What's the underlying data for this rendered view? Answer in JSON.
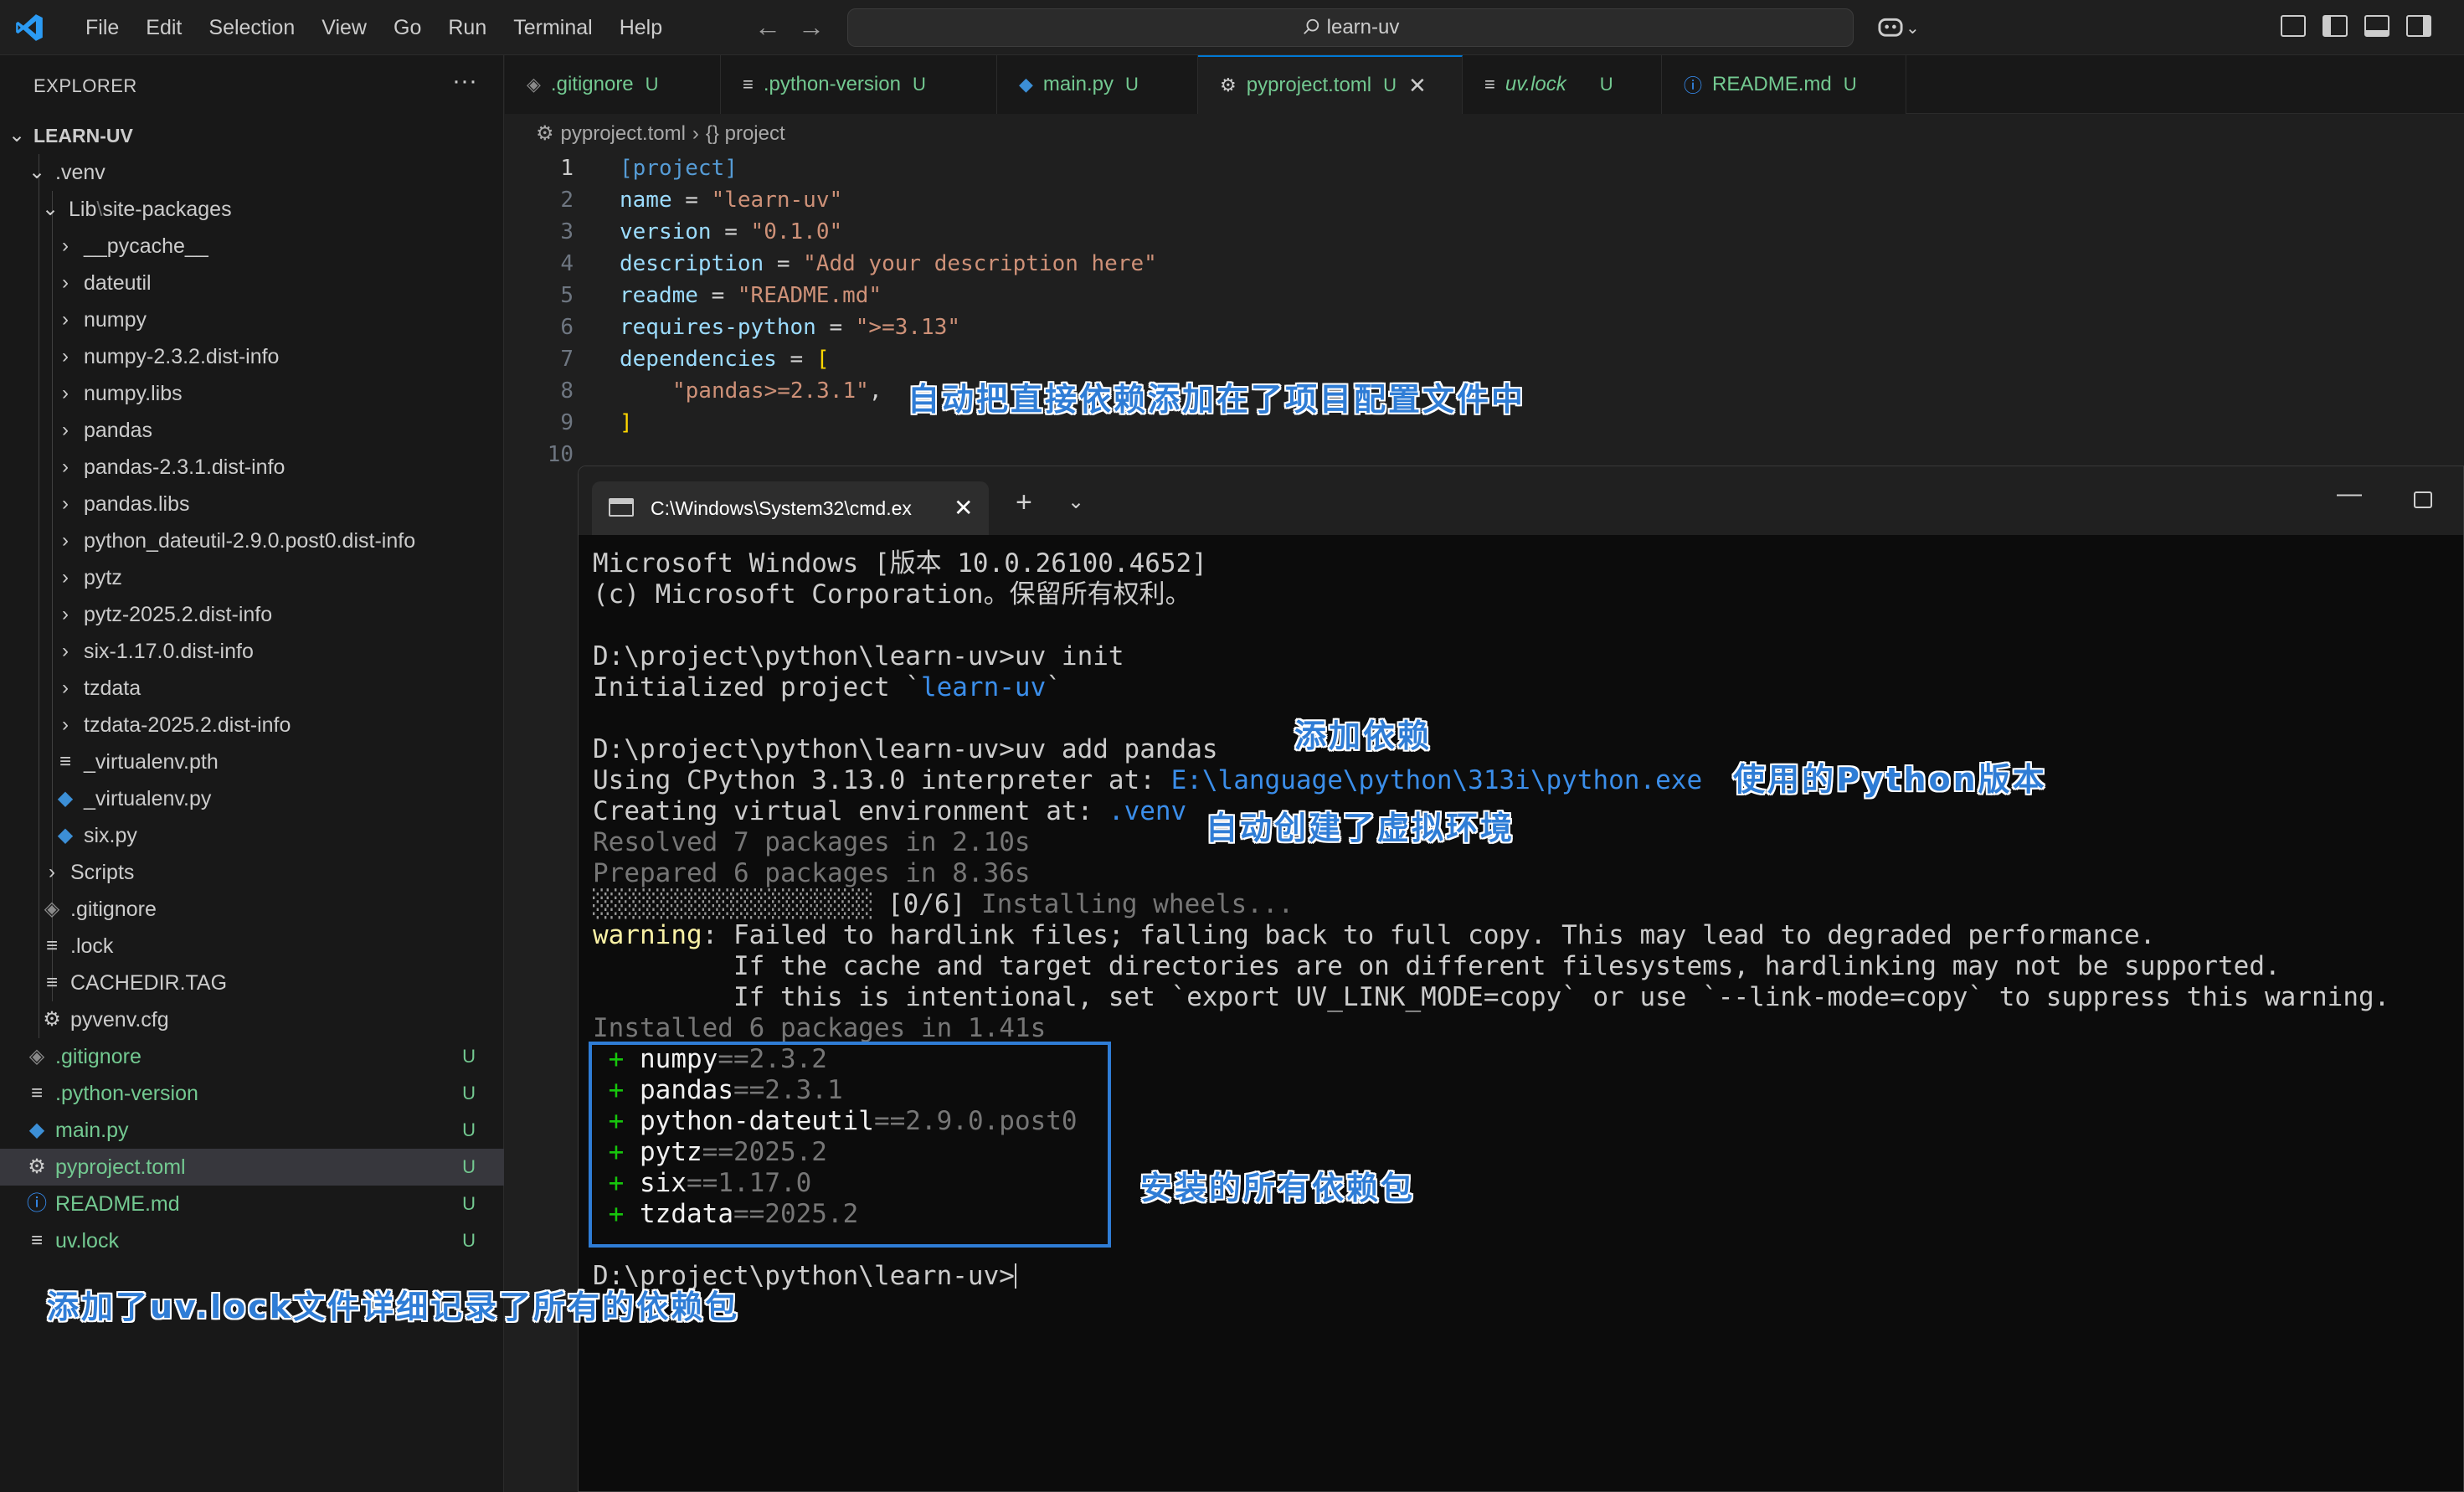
{
  "titlebar": {
    "menus": [
      "File",
      "Edit",
      "Selection",
      "View",
      "Go",
      "Run",
      "Terminal",
      "Help"
    ],
    "search_text": "learn-uv"
  },
  "sidebar": {
    "title": "EXPLORER",
    "more": "···",
    "root": "LEARN-UV",
    "venv": ".venv",
    "lib": "Lib",
    "lib_sep": "\\",
    "site_packages": "site-packages",
    "folders": [
      "__pycache__",
      "dateutil",
      "numpy",
      "numpy-2.3.2.dist-info",
      "numpy.libs",
      "pandas",
      "pandas-2.3.1.dist-info",
      "pandas.libs",
      "python_dateutil-2.9.0.post0.dist-info",
      "pytz",
      "pytz-2025.2.dist-info",
      "six-1.17.0.dist-info",
      "tzdata",
      "tzdata-2025.2.dist-info"
    ],
    "files": [
      "_virtualenv.pth",
      "_virtualenv.py",
      "six.py"
    ],
    "scripts": "Scripts",
    "venv_files": [
      ".gitignore",
      ".lock",
      "CACHEDIR.TAG",
      "pyvenv.cfg"
    ],
    "project_files": [
      {
        "name": ".gitignore",
        "status": "U"
      },
      {
        "name": ".python-version",
        "status": "U"
      },
      {
        "name": "main.py",
        "status": "U"
      },
      {
        "name": "pyproject.toml",
        "status": "U"
      },
      {
        "name": "README.md",
        "status": "U"
      },
      {
        "name": "uv.lock",
        "status": "U"
      }
    ]
  },
  "tabs": [
    {
      "label": ".gitignore",
      "status": "U"
    },
    {
      "label": ".python-version",
      "status": "U"
    },
    {
      "label": "main.py",
      "status": "U"
    },
    {
      "label": "pyproject.toml",
      "status": "U",
      "close": "✕"
    },
    {
      "label": "uv.lock",
      "status": "U"
    },
    {
      "label": "README.md",
      "status": "U"
    }
  ],
  "breadcrumb": {
    "file": "pyproject.toml",
    "sep": "›",
    "symbol": "{} project"
  },
  "editor": {
    "line_numbers": [
      "1",
      "2",
      "3",
      "4",
      "5",
      "6",
      "7",
      "8",
      "9",
      "10"
    ],
    "l1": "[project]",
    "l2_key": "name",
    "l2_val": "\"learn-uv\"",
    "l3_key": "version",
    "l3_val": "\"0.1.0\"",
    "l4_key": "description",
    "l4_val": "\"Add your description here\"",
    "l5_key": "readme",
    "l5_val": "\"README.md\"",
    "l6_key": "requires-python",
    "l6_val": "\">=3.13\"",
    "l7_key": "dependencies",
    "l7_open": "[",
    "l8_val": "\"pandas>=2.3.1\"",
    "l8_comma": ",",
    "l9_close": "]",
    "eq": " = "
  },
  "terminal": {
    "tab_title": "C:\\Windows\\System32\\cmd.ex",
    "tab_close": "✕",
    "new_tab": "+",
    "dropdown": "⌄",
    "minimize": "—",
    "lines": {
      "l1": "Microsoft Windows [版本 10.0.26100.4652]",
      "l2": "(c) Microsoft Corporation。保留所有权利。",
      "l3": "D:\\project\\python\\learn-uv>uv init",
      "l4a": "Initialized project `",
      "l4b": "learn-uv",
      "l4c": "`",
      "l5": "D:\\project\\python\\learn-uv>uv add pandas",
      "l6a": "Using CPython 3.13.0 interpreter at: ",
      "l6b": "E:\\language\\python\\313i\\python.exe",
      "l7a": "Creating virtual environment at: ",
      "l7b": ".venv",
      "l8": "Resolved 7 packages in 2.10s",
      "l9": "Prepared 6 packages in 8.36s",
      "l10a": "░░░░░░░░░░░░░░░░░░░░",
      "l10b": " [0/6] ",
      "l10c": "Installing wheels...",
      "l11a": "warning",
      "l11b": ": Failed to hardlink files; falling back to full copy. This may lead to degraded performance.",
      "l12": "         If the cache and target directories are on different filesystems, hardlinking may not be supported.",
      "l13": "         If this is intentional, set `export UV_LINK_MODE=copy` or use `--link-mode=copy` to suppress this warning.",
      "l14": "Installed 6 packages in 1.41s",
      "prompt": "D:\\project\\python\\learn-uv>"
    },
    "packages": [
      {
        "plus": " + ",
        "name": "numpy",
        "ver": "==2.3.2"
      },
      {
        "plus": " + ",
        "name": "pandas",
        "ver": "==2.3.1"
      },
      {
        "plus": " + ",
        "name": "python-dateutil",
        "ver": "==2.9.0.post0"
      },
      {
        "plus": " + ",
        "name": "pytz",
        "ver": "==2025.2"
      },
      {
        "plus": " + ",
        "name": "six",
        "ver": "==1.17.0"
      },
      {
        "plus": " + ",
        "name": "tzdata",
        "ver": "==2025.2"
      }
    ]
  },
  "annotations": {
    "deps_in_config": "自动把直接依赖添加在了项目配置文件中",
    "add_dep": "添加依赖",
    "python_version": "使用的Python版本",
    "venv_created": "自动创建了虚拟环境",
    "all_packages": "安装的所有依赖包",
    "uv_lock": "添加了uv.lock文件详细记录了所有的依赖包"
  },
  "colors": {
    "accent": "#0078d4",
    "annotation": "#2f7dd6",
    "git_untracked": "#73c991"
  }
}
